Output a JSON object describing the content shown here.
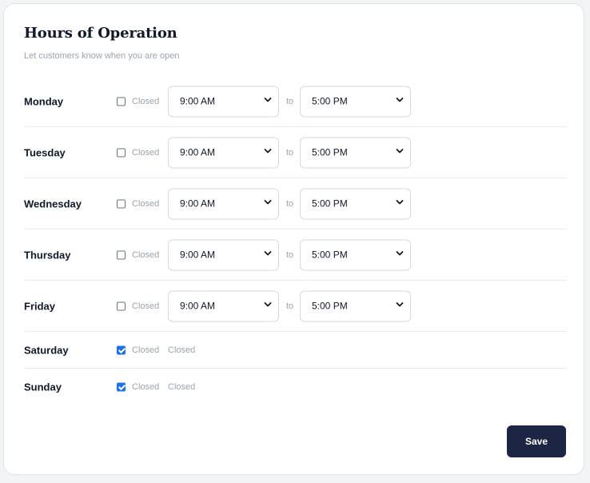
{
  "header": {
    "title": "Hours of Operation",
    "subtitle": "Let customers know when you are open"
  },
  "days": [
    {
      "day": "Monday",
      "closed": false,
      "checkbox_label": "Closed",
      "open": "9:00 AM",
      "close": "5:00 PM",
      "to_label": "to"
    },
    {
      "day": "Tuesday",
      "closed": false,
      "checkbox_label": "Closed",
      "open": "9:00 AM",
      "close": "5:00 PM",
      "to_label": "to"
    },
    {
      "day": "Wednesday",
      "closed": false,
      "checkbox_label": "Closed",
      "open": "9:00 AM",
      "close": "5:00 PM",
      "to_label": "to"
    },
    {
      "day": "Thursday",
      "closed": false,
      "checkbox_label": "Closed",
      "open": "9:00 AM",
      "close": "5:00 PM",
      "to_label": "to"
    },
    {
      "day": "Friday",
      "closed": false,
      "checkbox_label": "Closed",
      "open": "9:00 AM",
      "close": "5:00 PM",
      "to_label": "to"
    },
    {
      "day": "Saturday",
      "closed": true,
      "checkbox_label": "Closed",
      "closed_text": "Closed"
    },
    {
      "day": "Sunday",
      "closed": true,
      "checkbox_label": "Closed",
      "closed_text": "Closed"
    }
  ],
  "actions": {
    "save_label": "Save"
  },
  "colors": {
    "accent": "#1a73e8",
    "button": "#1c2541"
  }
}
